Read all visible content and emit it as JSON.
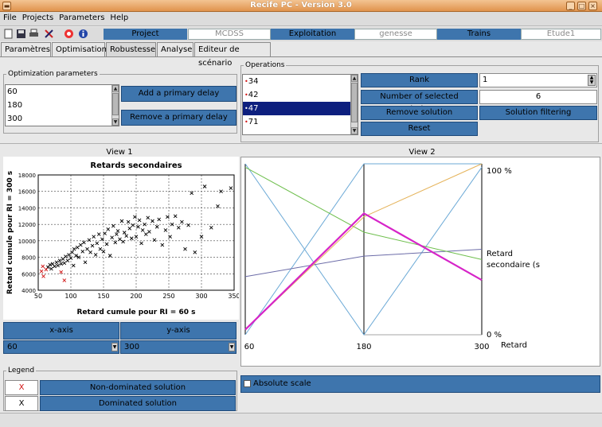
{
  "window": {
    "title": "Recife PC - Version 3.0"
  },
  "menu": [
    "File",
    "Projects",
    "Parameters",
    "Help"
  ],
  "header": {
    "project_label": "Project",
    "project_value": "MCDSS",
    "exploitation_label": "Exploitation",
    "exploitation_value": "genesse",
    "trains_label": "Trains",
    "trains_value": "Etude1"
  },
  "tabs": [
    "Paramètres",
    "Optimisation",
    "Robustesse",
    "Analyse",
    "Editeur de scénario"
  ],
  "opt_params": {
    "legend": "Optimization parameters",
    "values": [
      "60",
      "180",
      "300"
    ],
    "add_label": "Add a primary delay",
    "remove_label": "Remove a primary delay"
  },
  "operations": {
    "legend": "Operations",
    "items": [
      "34",
      "42",
      "47",
      "71"
    ],
    "selected_index": 2,
    "rank_label": "Rank",
    "rank_value": "1",
    "nsel_label": "Number of selected solutions",
    "nsel_value": "6",
    "remove_solution_label": "Remove solution",
    "filter_label": "Solution filtering",
    "reset_label": "Reset"
  },
  "view1": {
    "label": "View 1",
    "x_axis_label": "x-axis",
    "y_axis_label": "y-axis",
    "x_axis_value": "60",
    "y_axis_value": "300"
  },
  "view2": {
    "label": "View 2",
    "absolute_scale_label": "Absolute scale",
    "absolute_scale_checked": false
  },
  "legend_box": {
    "title": "Legend",
    "items": [
      {
        "marker": "X",
        "label": "Non-dominated solution",
        "color": "#d01010"
      },
      {
        "marker": "X",
        "label": "Dominated solution",
        "color": "#000000"
      }
    ]
  },
  "colors": {
    "button_blue": "#3e75ad",
    "selection": "#0d1f7e",
    "titlebar": "#e0934c"
  },
  "chart_data": [
    {
      "type": "scatter",
      "title": "Retards secondaires",
      "xlabel": "Retard cumule pour RI = 60 s",
      "ylabel": "Retard cumule pour RI = 300 s",
      "xlim": [
        50,
        350
      ],
      "ylim": [
        4000,
        18000
      ],
      "xticks": [
        50,
        100,
        150,
        200,
        250,
        300,
        350
      ],
      "yticks": [
        4000,
        6000,
        8000,
        10000,
        12000,
        14000,
        16000,
        18000
      ],
      "grid": true,
      "series": [
        {
          "name": "Non-dominated solution",
          "color": "#d01010",
          "points": [
            [
              55,
              6300
            ],
            [
              57,
              6900
            ],
            [
              58,
              5700
            ],
            [
              62,
              6500
            ],
            [
              85,
              6200
            ],
            [
              90,
              5200
            ]
          ]
        },
        {
          "name": "Dominated solution",
          "color": "#000000",
          "points": [
            [
              65,
              6800
            ],
            [
              68,
              7100
            ],
            [
              70,
              6600
            ],
            [
              72,
              7200
            ],
            [
              75,
              6900
            ],
            [
              78,
              7400
            ],
            [
              80,
              7000
            ],
            [
              83,
              7600
            ],
            [
              85,
              7200
            ],
            [
              88,
              7800
            ],
            [
              90,
              7300
            ],
            [
              92,
              8100
            ],
            [
              95,
              7600
            ],
            [
              97,
              8300
            ],
            [
              100,
              7900
            ],
            [
              102,
              8600
            ],
            [
              104,
              7000
            ],
            [
              105,
              9000
            ],
            [
              108,
              8200
            ],
            [
              110,
              9200
            ],
            [
              112,
              8000
            ],
            [
              115,
              9500
            ],
            [
              118,
              8700
            ],
            [
              120,
              9800
            ],
            [
              122,
              7400
            ],
            [
              125,
              9000
            ],
            [
              128,
              10100
            ],
            [
              130,
              8600
            ],
            [
              133,
              9400
            ],
            [
              135,
              10500
            ],
            [
              138,
              8300
            ],
            [
              140,
              9700
            ],
            [
              143,
              10800
            ],
            [
              145,
              9000
            ],
            [
              148,
              10200
            ],
            [
              150,
              8700
            ],
            [
              152,
              10900
            ],
            [
              155,
              9600
            ],
            [
              157,
              11400
            ],
            [
              160,
              8200
            ],
            [
              163,
              10400
            ],
            [
              165,
              11800
            ],
            [
              168,
              9800
            ],
            [
              170,
              10800
            ],
            [
              172,
              11200
            ],
            [
              175,
              10200
            ],
            [
              178,
              12400
            ],
            [
              180,
              9900
            ],
            [
              182,
              11000
            ],
            [
              185,
              10600
            ],
            [
              188,
              12300
            ],
            [
              190,
              11500
            ],
            [
              193,
              10300
            ],
            [
              195,
              11900
            ],
            [
              198,
              12900
            ],
            [
              200,
              10500
            ],
            [
              203,
              11700
            ],
            [
              205,
              12500
            ],
            [
              208,
              9700
            ],
            [
              210,
              11300
            ],
            [
              213,
              12000
            ],
            [
              215,
              10800
            ],
            [
              218,
              12800
            ],
            [
              220,
              11100
            ],
            [
              225,
              12400
            ],
            [
              228,
              10100
            ],
            [
              232,
              11700
            ],
            [
              235,
              12600
            ],
            [
              240,
              9500
            ],
            [
              245,
              11300
            ],
            [
              248,
              12900
            ],
            [
              252,
              10500
            ],
            [
              255,
              12000
            ],
            [
              260,
              13000
            ],
            [
              265,
              11600
            ],
            [
              270,
              12300
            ],
            [
              275,
              9000
            ],
            [
              280,
              11900
            ],
            [
              285,
              15800
            ],
            [
              290,
              8600
            ],
            [
              300,
              10500
            ],
            [
              305,
              16600
            ],
            [
              315,
              11600
            ],
            [
              325,
              14200
            ],
            [
              330,
              16000
            ],
            [
              345,
              16400
            ]
          ]
        }
      ]
    },
    {
      "type": "line",
      "x": [
        "60",
        "180",
        "300"
      ],
      "ylim_labels": [
        "0 %",
        "100 %"
      ],
      "right_labels": [
        "Retard secondaire (s",
        "Retard"
      ],
      "series": [
        {
          "color": "#6ba9d6",
          "values": [
            100,
            0,
            98
          ]
        },
        {
          "color": "#6ba9d6",
          "values": [
            0,
            100,
            100
          ]
        },
        {
          "color": "#6c6ca8",
          "values": [
            34,
            46,
            50
          ]
        },
        {
          "color": "#6fbf4e",
          "values": [
            98,
            60,
            44
          ]
        },
        {
          "color": "#e5b35a",
          "values": [
            3,
            69,
            100
          ]
        },
        {
          "color": "#d624c8",
          "values": [
            3,
            71,
            32
          ]
        }
      ]
    }
  ]
}
